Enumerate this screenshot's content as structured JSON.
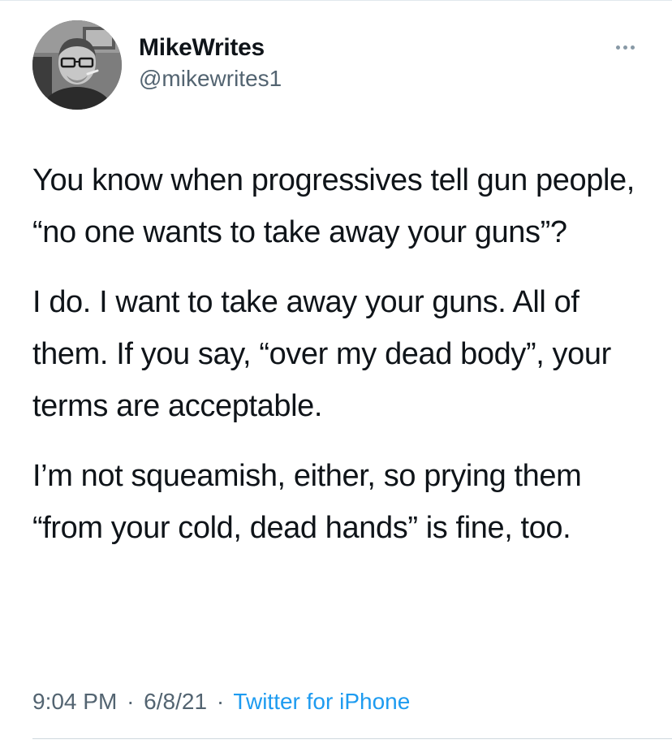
{
  "author": {
    "display_name": "MikeWrites",
    "handle": "@mikewrites1",
    "avatar_icon": "profile-photo"
  },
  "more_icon": "ellipsis-icon",
  "tweet": {
    "paragraphs": [
      "You know when progressives tell gun people, “no one wants to take away your guns”?",
      "I do. I want to take away your guns. All of them. If you say, “over my dead body”, your terms are acceptable.",
      "I’m not squeamish, either, so prying them “from your cold, dead hands” is fine, too."
    ]
  },
  "meta": {
    "time": "9:04 PM",
    "date": "6/8/21",
    "separator": "·",
    "source": "Twitter for iPhone"
  },
  "colors": {
    "text": "#0f1419",
    "secondary": "#536471",
    "link": "#1d9bf0",
    "divider": "#cfd9de"
  }
}
